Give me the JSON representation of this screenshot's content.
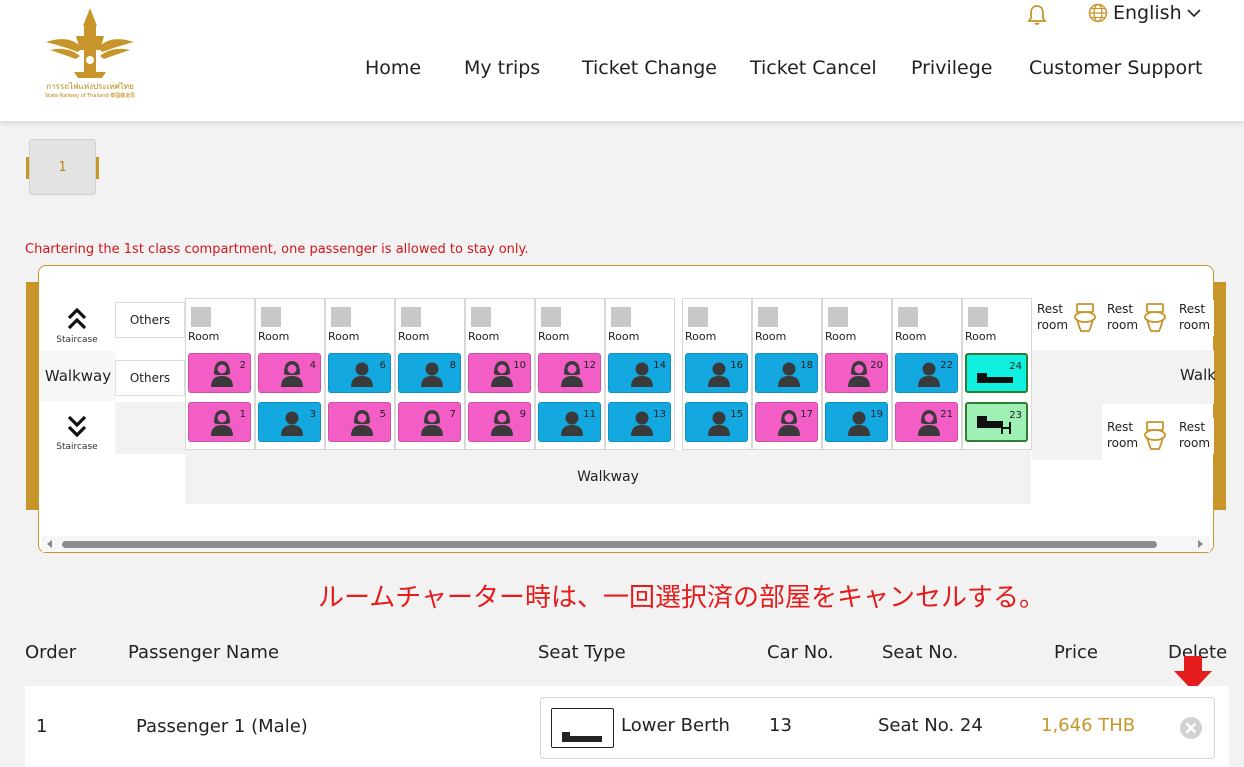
{
  "header": {
    "logo_text_th": "การรถไฟแห่งประเทศไทย",
    "logo_text_en": "State Railway of Thailand 泰國鐵道局",
    "language": "English",
    "nav": [
      "Home",
      "My trips",
      "Ticket Change",
      "Ticket Cancel",
      "Privilege",
      "Customer Support"
    ]
  },
  "car_tab": {
    "label": "1"
  },
  "notice": "Chartering the 1st class compartment, one passenger is allowed to stay only.",
  "seat_map": {
    "staircase_label": "Staircase",
    "walkway_label": "Walkway",
    "walkway_right_label": "Walk",
    "others_label": "Others",
    "room_label": "Room",
    "restroom_line1": "Rest",
    "restroom_line2": "room",
    "rooms": [
      {
        "upper": {
          "num": "2",
          "type": "female"
        },
        "lower": {
          "num": "1",
          "type": "female"
        }
      },
      {
        "upper": {
          "num": "4",
          "type": "female"
        },
        "lower": {
          "num": "3",
          "type": "male"
        }
      },
      {
        "upper": {
          "num": "6",
          "type": "male"
        },
        "lower": {
          "num": "5",
          "type": "female"
        }
      },
      {
        "upper": {
          "num": "8",
          "type": "male"
        },
        "lower": {
          "num": "7",
          "type": "female"
        }
      },
      {
        "upper": {
          "num": "10",
          "type": "female"
        },
        "lower": {
          "num": "9",
          "type": "female"
        }
      },
      {
        "upper": {
          "num": "12",
          "type": "female"
        },
        "lower": {
          "num": "11",
          "type": "male"
        }
      },
      {
        "upper": {
          "num": "14",
          "type": "male"
        },
        "lower": {
          "num": "13",
          "type": "male"
        }
      },
      {
        "upper": {
          "num": "16",
          "type": "male"
        },
        "lower": {
          "num": "15",
          "type": "male"
        }
      },
      {
        "upper": {
          "num": "18",
          "type": "male"
        },
        "lower": {
          "num": "17",
          "type": "female"
        }
      },
      {
        "upper": {
          "num": "20",
          "type": "female"
        },
        "lower": {
          "num": "19",
          "type": "male"
        }
      },
      {
        "upper": {
          "num": "22",
          "type": "male"
        },
        "lower": {
          "num": "21",
          "type": "female"
        }
      },
      {
        "upper": {
          "num": "24",
          "type": "selected-lower-berth"
        },
        "lower": {
          "num": "23",
          "type": "selected-upper-berth"
        }
      }
    ],
    "colors": {
      "female": "#f25ec5",
      "male": "#14a8e0",
      "selected": "#10f0e0",
      "selected_alt": "#9ef0b4",
      "accent": "#c8952a"
    }
  },
  "annotation_jp": "ルームチャーター時は、一回選択済の部屋をキャンセルする。",
  "table": {
    "headers": [
      "Order",
      "Passenger Name",
      "Seat Type",
      "Car No.",
      "Seat No.",
      "Price",
      "Delete"
    ],
    "rows": [
      {
        "order": "1",
        "passenger": "Passenger 1 (Male)",
        "seat_type": "Lower Berth",
        "car_no": "13",
        "seat_no": "Seat No. 24",
        "price": "1,646 THB"
      }
    ]
  }
}
